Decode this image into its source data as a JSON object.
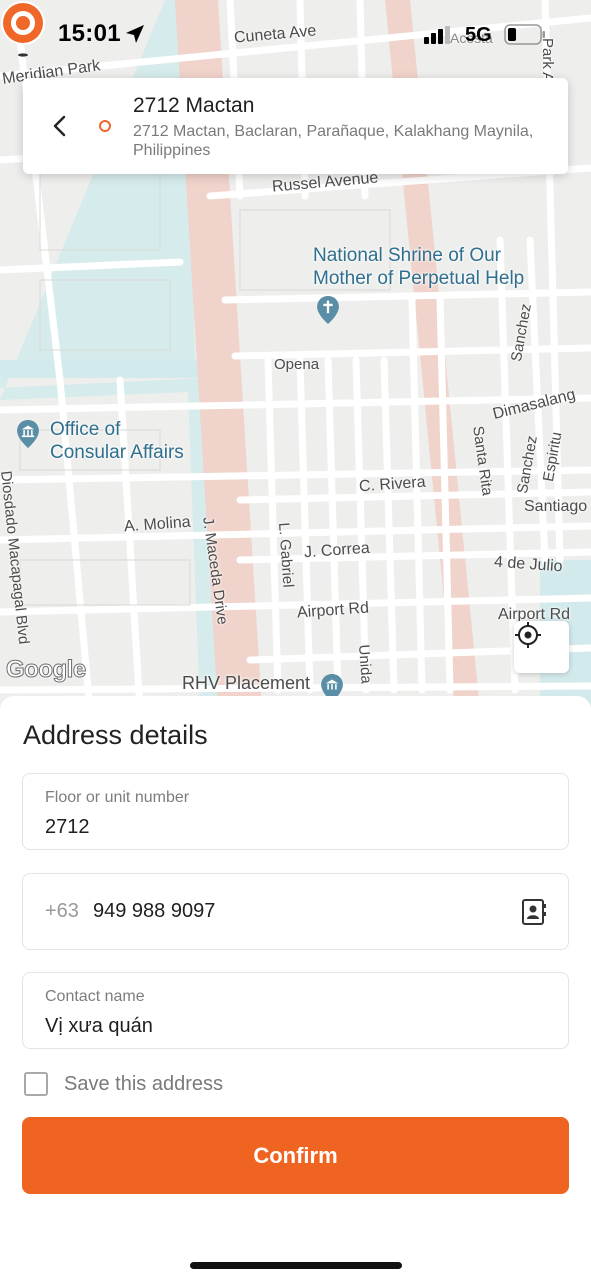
{
  "status_bar": {
    "time": "15:01",
    "network": "5G",
    "icons": [
      "location-arrow-icon",
      "signal-icon",
      "battery-icon"
    ]
  },
  "address_card": {
    "title": "2712 Mactan",
    "subtitle": "2712 Mactan, Baclaran, Parañaque, Kalakhang Maynila, Philippines",
    "icons": [
      "back-arrow-icon",
      "origin-dot-icon"
    ]
  },
  "map": {
    "streets": {
      "cuneta": "Cuneta Ave",
      "meridian": "Meridian Park",
      "park_ave": "Park Ave",
      "acosta": "Acosta",
      "russel": "Russel Avenue",
      "opena": "Opena",
      "sanchez_top": "Sanchez",
      "dimasalang": "Dimasalang",
      "santa_rita": "Santa Rita",
      "sanchez": "Sanchez",
      "espiritu": "Espiritu",
      "c_rivera": "C. Rivera",
      "santiago": "Santiago",
      "diosdado": "Diosdado Macapagal Blvd",
      "a_molina": "A. Molina",
      "j_maceda": "J. Maceda Drive",
      "l_gabriel": "L. Gabriel",
      "j_correa": "J. Correa",
      "de_julio": "4 de Julio",
      "airport_rd_1": "Airport Rd",
      "airport_rd_2": "Airport Rd",
      "unida": "Unida"
    },
    "pois": {
      "shrine": "National Shrine of Our Mother of Perpetual Help",
      "shrine_line1": "National Shrine of Our",
      "shrine_line2": "Mother of Perpetual Help",
      "consular_line1": "Office of",
      "consular_line2": "Consular Affairs",
      "rhv": "RHV Placement"
    },
    "google_logo": "Google",
    "colors": {
      "road_major": "#f1d4cc",
      "road_minor": "#ffffff",
      "canal": "#cfe8ea",
      "block": "#ecebe8",
      "pin": "#f0672a"
    }
  },
  "sheet": {
    "title": "Address details",
    "floor": {
      "label": "Floor or unit number",
      "value": "2712"
    },
    "phone": {
      "prefix": "+63",
      "value": "949 988 9097",
      "icon": "contacts-book-icon"
    },
    "contact": {
      "label": "Contact name",
      "value": "Vị xưa quán"
    },
    "save": {
      "label": "Save this address",
      "checked": false
    },
    "confirm_label": "Confirm",
    "accent": "#f06422"
  }
}
